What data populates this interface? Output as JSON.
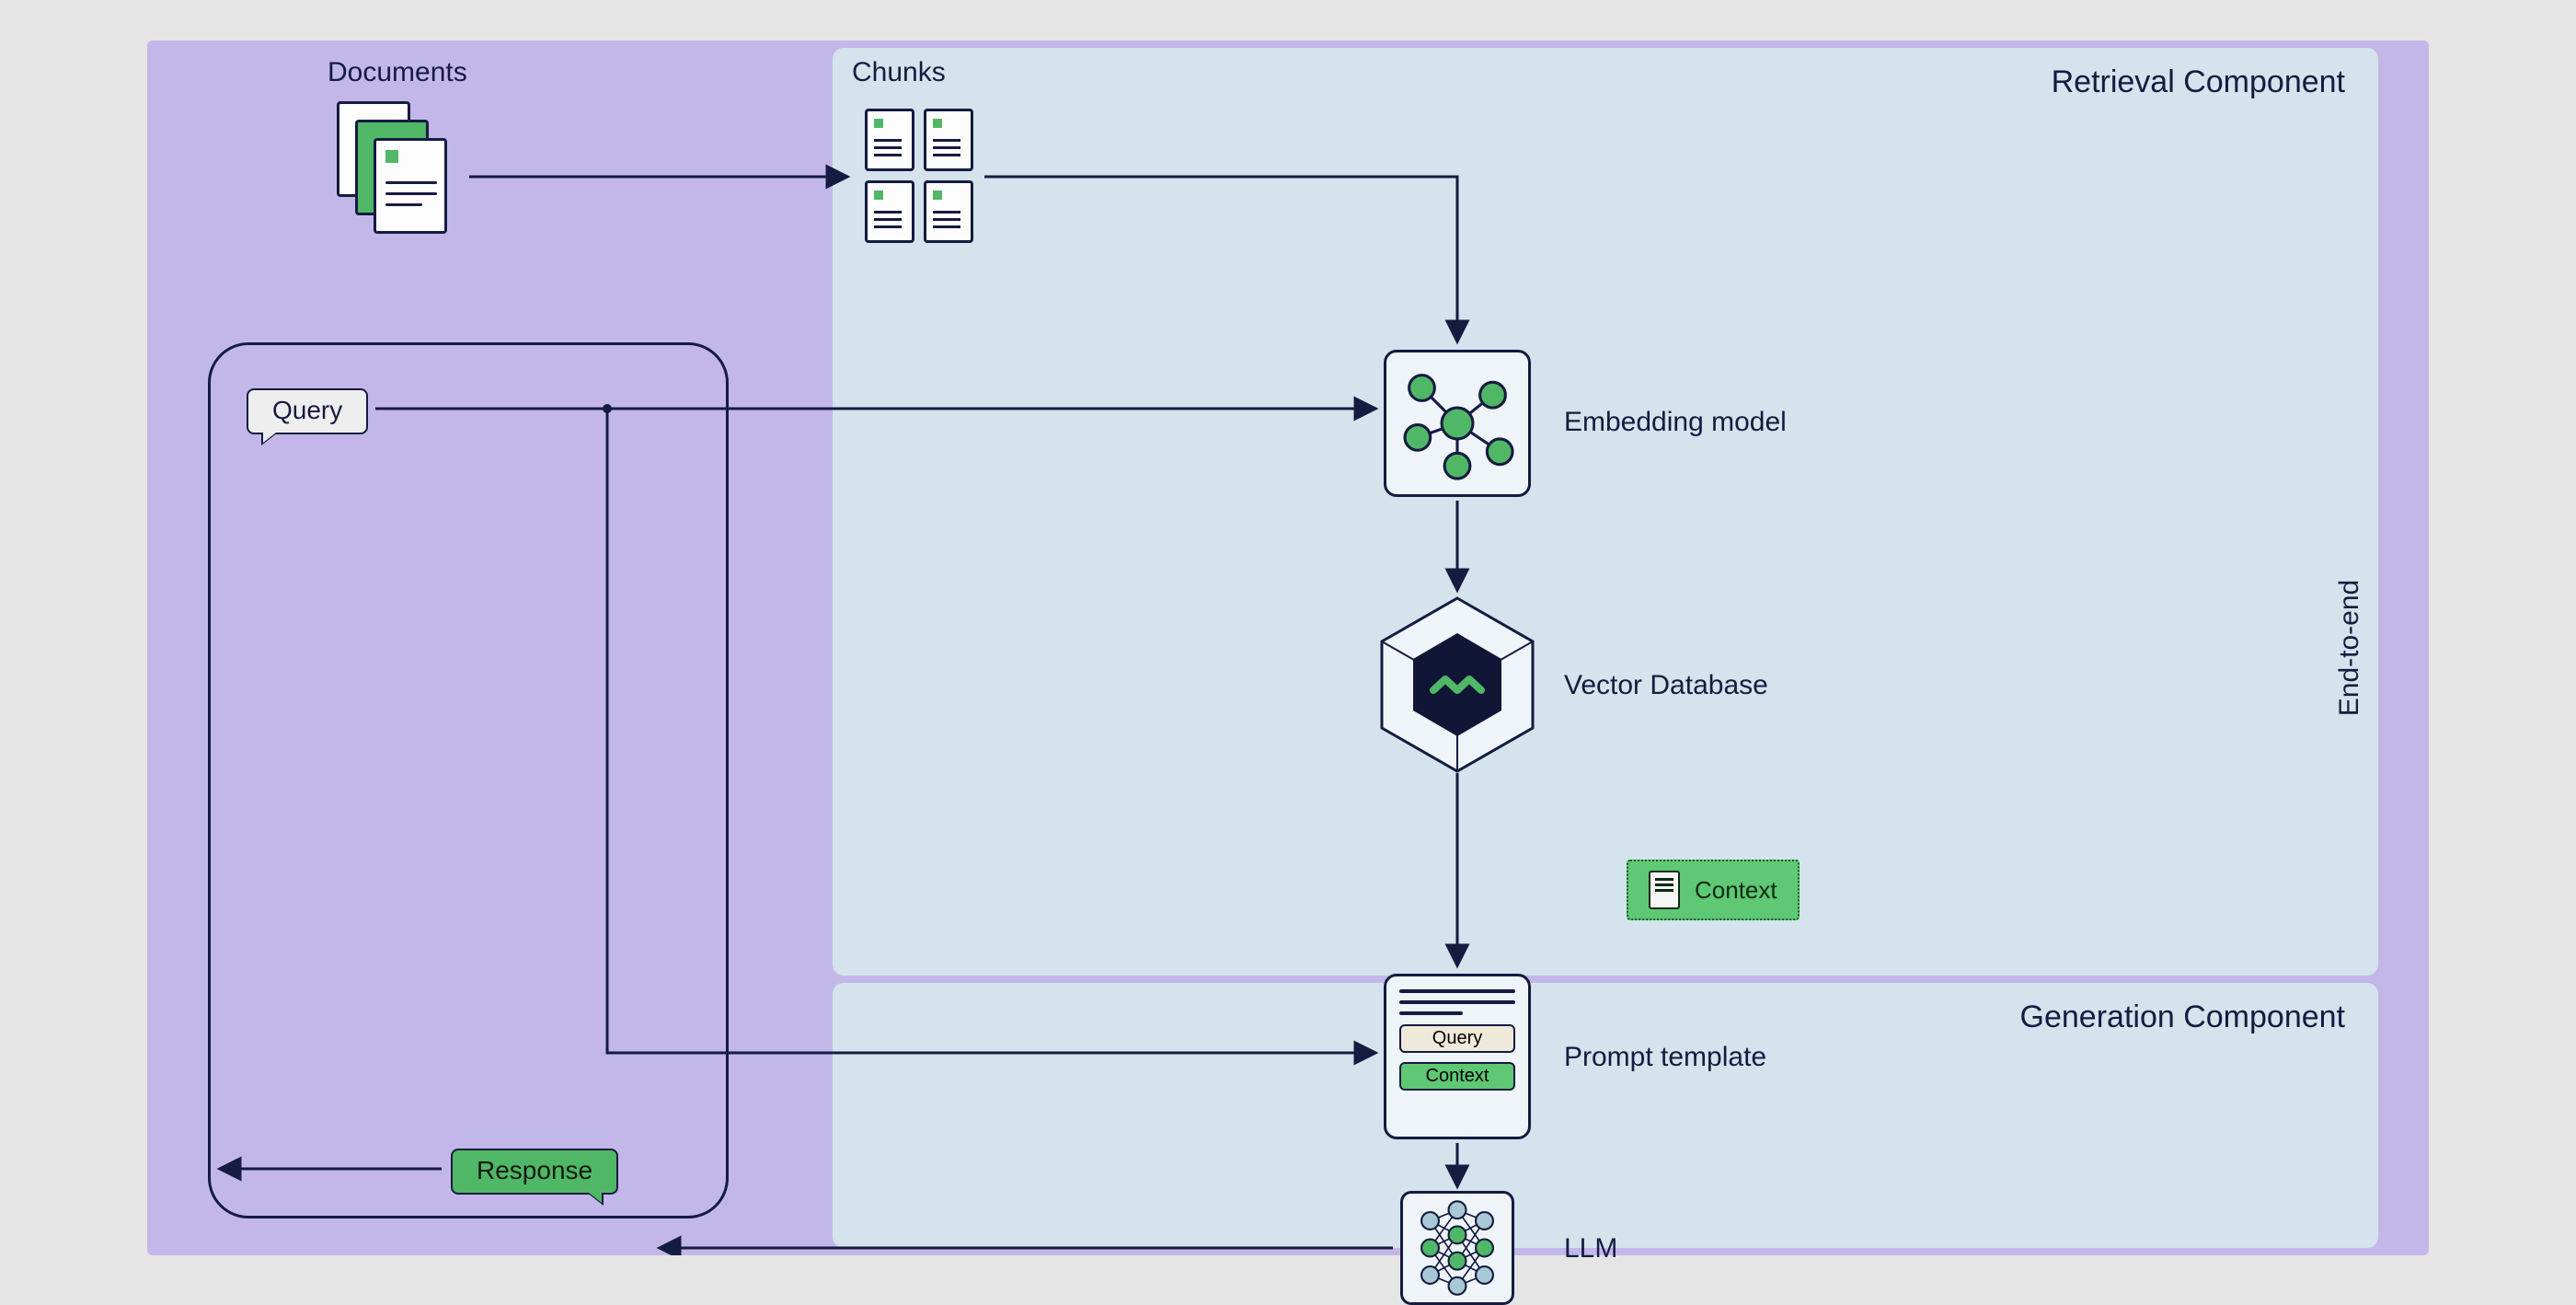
{
  "labels": {
    "documents": "Documents",
    "chunks": "Chunks",
    "query": "Query",
    "response": "Response",
    "embedding": "Embedding model",
    "vectordb": "Vector Database",
    "context": "Context",
    "prompt": "Prompt template",
    "llm": "LLM",
    "pt_query": "Query",
    "pt_context": "Context"
  },
  "panels": {
    "retrieval": "Retrieval Component",
    "generation": "Generation Component"
  },
  "side": {
    "end_to_end": "End-to-end"
  },
  "colors": {
    "stage": "#c3b7e9",
    "panel": "#d4e3ec",
    "ink": "#151b41",
    "green": "#4fb766"
  }
}
